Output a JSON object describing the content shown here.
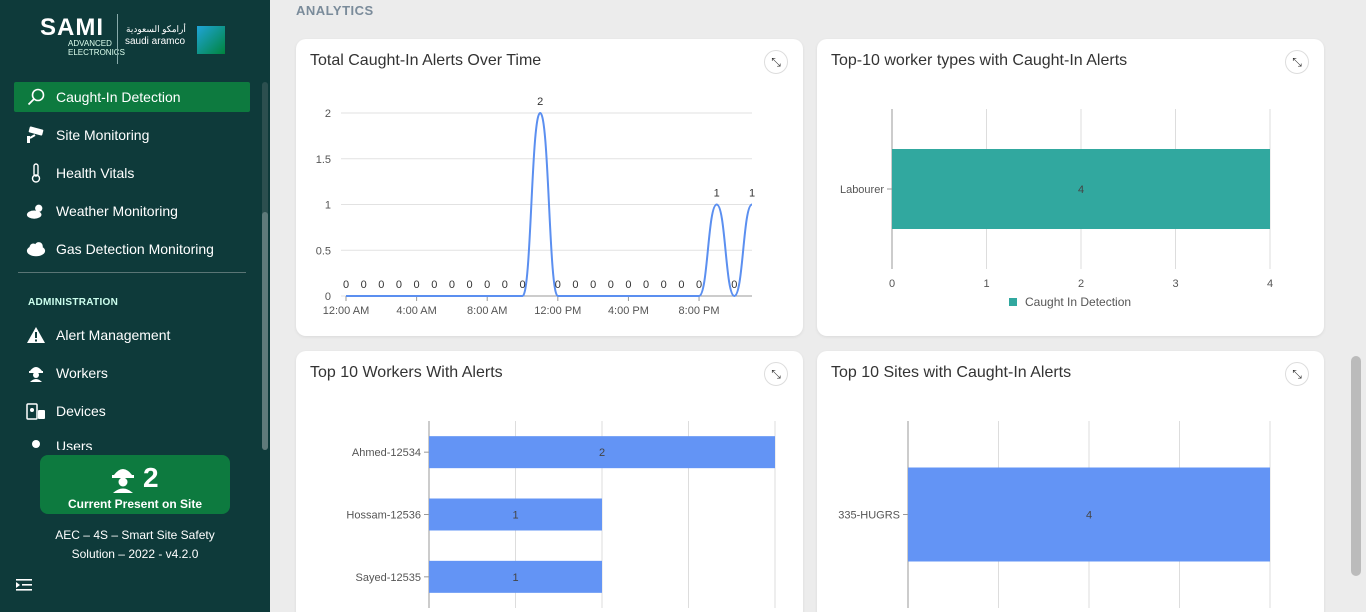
{
  "brand": {
    "sami": "SAMI",
    "advanced": "ADVANCED",
    "electronics": "ELECTRONICS",
    "aramco_ar": "أرامكو السعودية",
    "aramco_en": "saudi aramco"
  },
  "sidebar": {
    "items": [
      {
        "label": "Caught-In Detection",
        "icon": "magnifier-icon",
        "active": true
      },
      {
        "label": "Site Monitoring",
        "icon": "cctv-icon"
      },
      {
        "label": "Health Vitals",
        "icon": "thermometer-icon"
      },
      {
        "label": "Weather Monitoring",
        "icon": "weather-icon"
      },
      {
        "label": "Gas Detection Monitoring",
        "icon": "gas-cloud-icon"
      }
    ],
    "admin_label": "ADMINISTRATION",
    "admin_items": [
      {
        "label": "Alert Management",
        "icon": "warning-icon"
      },
      {
        "label": "Workers",
        "icon": "worker-icon"
      },
      {
        "label": "Devices",
        "icon": "device-icon"
      },
      {
        "label": "Users",
        "icon": "user-icon"
      }
    ],
    "present_count": "2",
    "present_label": "Current Present on Site",
    "version_line1": "AEC – 4S – Smart Site Safety",
    "version_line2": "Solution – 2022 - v4.2.0"
  },
  "main": {
    "section_title": "ANALYTICS",
    "cards": [
      {
        "title": "Total Caught-In Alerts Over Time"
      },
      {
        "title": "Top-10 worker types with Caught-In Alerts"
      },
      {
        "title": "Top 10 Workers With Alerts"
      },
      {
        "title": "Top 10 Sites with Caught-In Alerts"
      }
    ]
  },
  "chart_data": [
    {
      "type": "line",
      "title": "Total Caught-In Alerts Over Time",
      "x_ticks": [
        "12:00 AM",
        "4:00 AM",
        "8:00 AM",
        "12:00 PM",
        "4:00 PM",
        "8:00 PM"
      ],
      "y_ticks": [
        "0",
        "0.5",
        "1",
        "1.5",
        "2"
      ],
      "ylim": [
        0,
        2
      ],
      "series": [
        {
          "values": [
            0,
            0,
            0,
            0,
            0,
            0,
            0,
            0,
            0,
            0,
            0,
            2,
            0,
            0,
            0,
            0,
            0,
            0,
            0,
            0,
            0,
            1,
            0,
            1
          ]
        }
      ],
      "color": "#5b8ff0"
    },
    {
      "type": "bar",
      "title": "Top-10 worker types with Caught-In Alerts",
      "categories": [
        "Labourer"
      ],
      "values": [
        4
      ],
      "x_ticks": [
        "0",
        "1",
        "2",
        "3",
        "4"
      ],
      "xlim": [
        0,
        4
      ],
      "legend": "Caught In Detection",
      "color": "#31a89f"
    },
    {
      "type": "bar",
      "title": "Top 10 Workers With Alerts",
      "categories": [
        "Ahmed-12534",
        "Hossam-12536",
        "Sayed-12535"
      ],
      "values": [
        2,
        1,
        1
      ],
      "xlim": [
        0,
        2
      ],
      "color": "#6394f5"
    },
    {
      "type": "bar",
      "title": "Top 10 Sites with Caught-In Alerts",
      "categories": [
        "335-HUGRS"
      ],
      "values": [
        4
      ],
      "xlim": [
        0,
        4
      ],
      "color": "#6394f5"
    }
  ]
}
